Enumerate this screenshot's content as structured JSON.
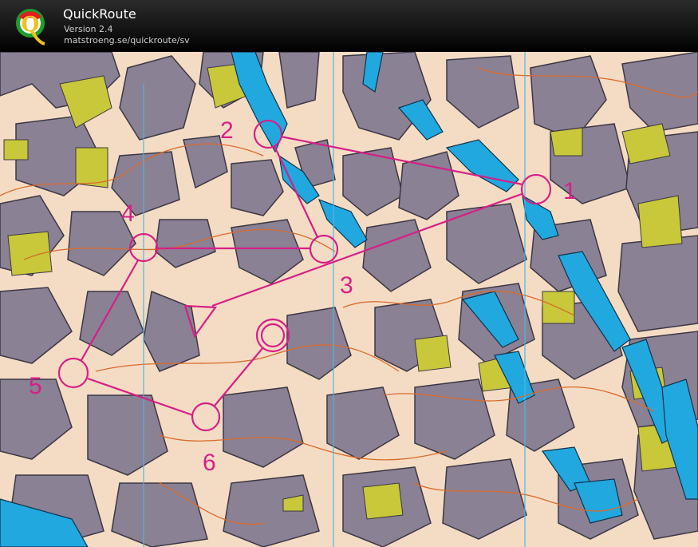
{
  "app": {
    "title": "QuickRoute",
    "version": "Version 2.4",
    "url": "matstroeng.se/quickroute/sv",
    "logo_letter": "Q",
    "logo_icon": "quickroute-q-logo-icon"
  },
  "colors": {
    "paper": "#f4dcc4",
    "building": "#8a8194",
    "canopy": "#c8c83a",
    "water": "#21a8df",
    "contour": "#d96a2b",
    "course": "#d61f87",
    "north_line": "#4fb6e2"
  },
  "course": {
    "start_symbol": "start-triangle-icon",
    "finish_symbol": "finish-double-circle-icon",
    "controls": [
      {
        "number": "1"
      },
      {
        "number": "2"
      },
      {
        "number": "3"
      },
      {
        "number": "4"
      },
      {
        "number": "5"
      },
      {
        "number": "6"
      }
    ]
  }
}
